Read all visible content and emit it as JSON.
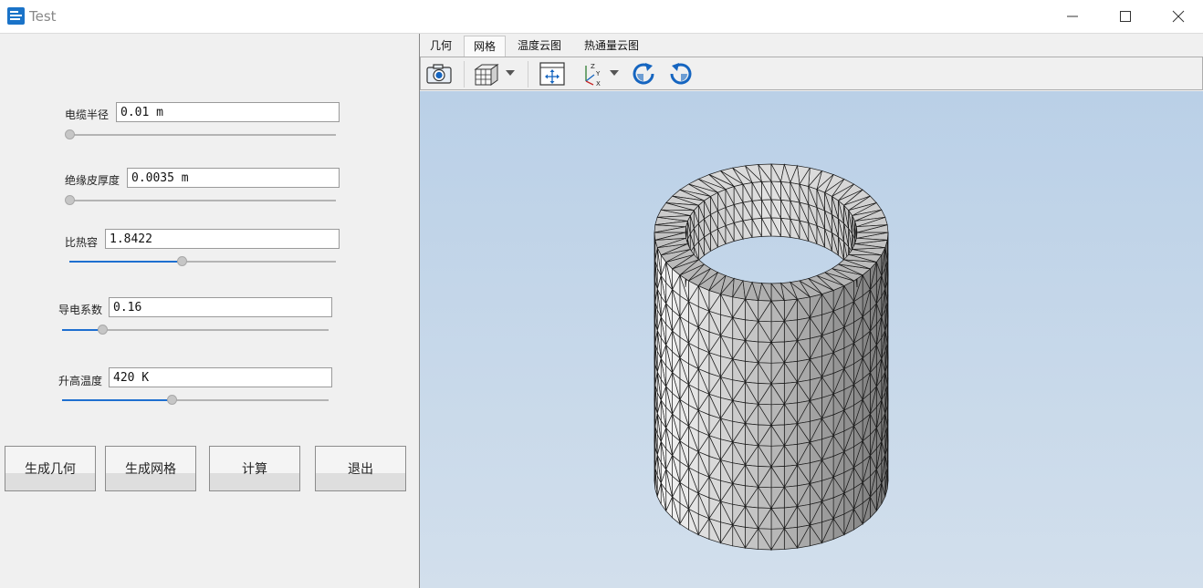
{
  "window": {
    "title": "Test"
  },
  "params": [
    {
      "label": "电缆半径",
      "value": "0.01 m",
      "slider_fraction": 0.0
    },
    {
      "label": "绝缘皮厚度",
      "value": "0.0035 m",
      "slider_fraction": 0.0
    },
    {
      "label": "比热容",
      "value": "1.8422",
      "slider_fraction": 0.42
    },
    {
      "label": "导电系数",
      "value": "0.16",
      "slider_fraction": 0.15
    },
    {
      "label": "升高温度",
      "value": "420 K",
      "slider_fraction": 0.41
    }
  ],
  "buttons": {
    "geometry": "生成几何",
    "mesh": "生成网格",
    "compute": "计算",
    "exit": "退出"
  },
  "tabs": [
    "几何",
    "网格",
    "温度云图",
    "热通量云图"
  ],
  "active_tab": "网格",
  "colors": {
    "viewport_top": "#bad0e7",
    "viewport_bottom": "#d2dfec",
    "slider_fill": "#1e6fd0",
    "mesh_face": "#d6d6d6",
    "mesh_edge": "#1a1a1a",
    "accent_icon": "#1565c0"
  },
  "toolbar_icons": [
    "camera-icon",
    "view-cube-icon",
    "fit-view-icon",
    "axes-icon",
    "rotate-cw-icon",
    "rotate-ccw-icon"
  ]
}
